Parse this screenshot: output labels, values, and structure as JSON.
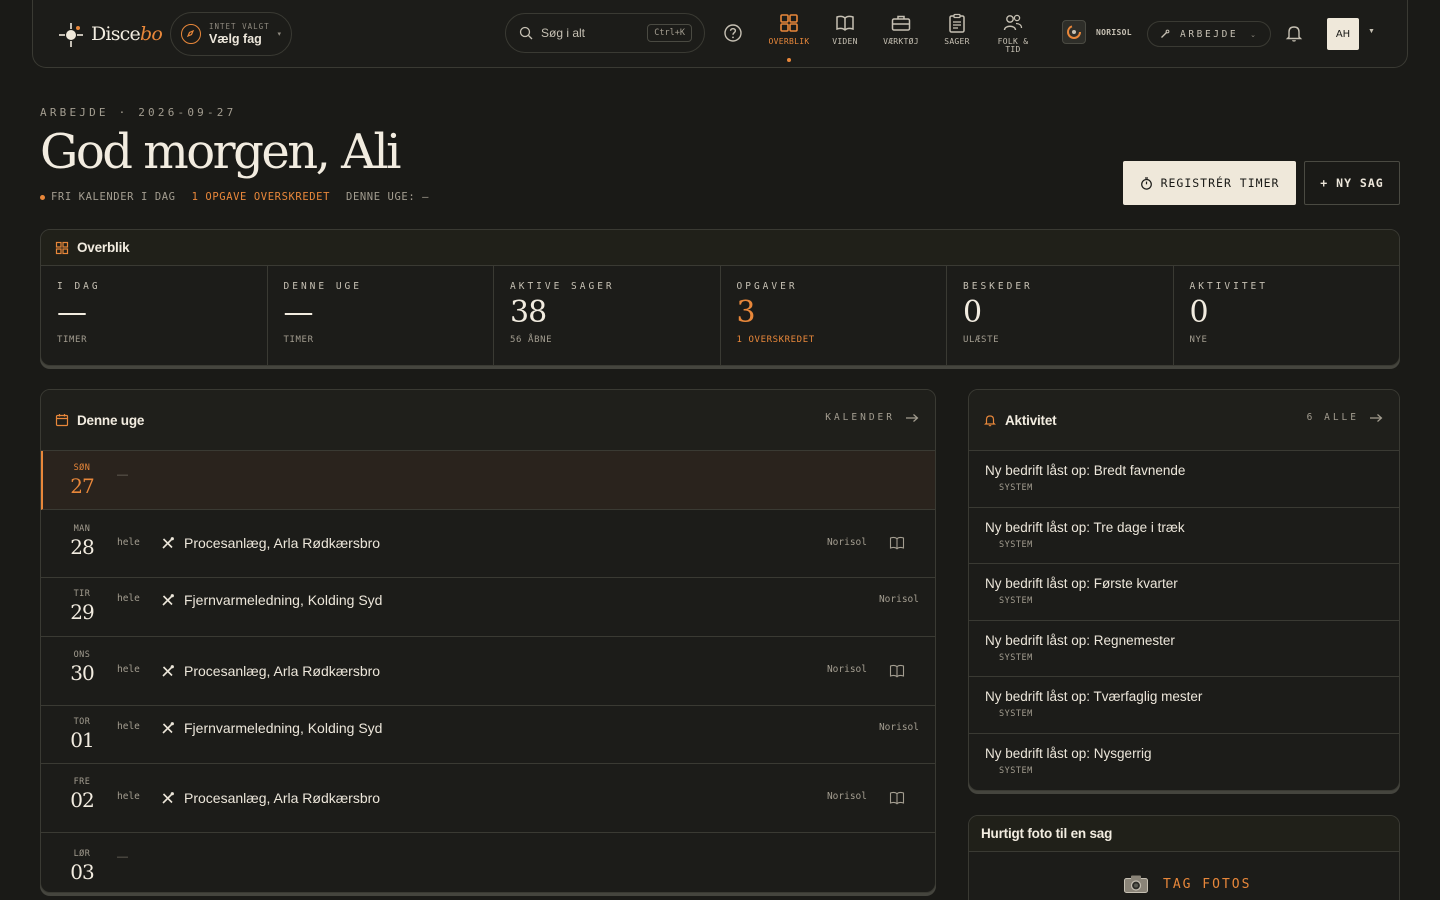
{
  "brand": {
    "name_main": "Disce",
    "name_italic": "bo"
  },
  "fag": {
    "small": "INTET VALGT",
    "label": "Vælg fag"
  },
  "search": {
    "placeholder": "Søg i alt",
    "shortcut": "Ctrl+K"
  },
  "nav": [
    {
      "label": "OVERBLIK",
      "icon": "grid-icon",
      "active": true
    },
    {
      "label": "VIDEN",
      "icon": "book-icon",
      "active": false
    },
    {
      "label": "VÆRKTØJ",
      "icon": "toolbox-icon",
      "active": false
    },
    {
      "label": "SAGER",
      "icon": "clipboard-icon",
      "active": false
    },
    {
      "label": "FOLK & TID",
      "icon": "people-icon",
      "active": false
    }
  ],
  "company": {
    "name": "NORISOL"
  },
  "mode": {
    "label": "ARBEJDE"
  },
  "user": {
    "initials": "AH"
  },
  "header": {
    "eyebrow": "ARBEJDE · 2026-09-27",
    "greeting": "God morgen, Ali",
    "status_free": "FRI KALENDER I DAG",
    "status_overdue": "1 OPGAVE OVERSKREDET",
    "status_week": "DENNE UGE: —",
    "btn_register": "REGISTRÉR TIMER",
    "btn_new": "+ NY SAG"
  },
  "overview": {
    "title": "Overblik",
    "stats": [
      {
        "label": "I DAG",
        "value": "—",
        "sub": "TIMER",
        "accent": false
      },
      {
        "label": "DENNE UGE",
        "value": "—",
        "sub": "TIMER",
        "accent": false
      },
      {
        "label": "AKTIVE SAGER",
        "value": "38",
        "sub": "56 ÅBNE",
        "accent": false
      },
      {
        "label": "OPGAVER",
        "value": "3",
        "sub": "1 OVERSKREDET",
        "accent": true
      },
      {
        "label": "BESKEDER",
        "value": "0",
        "sub": "ULÆSTE",
        "accent": false
      },
      {
        "label": "AKTIVITET",
        "value": "0",
        "sub": "NYE",
        "accent": false
      }
    ]
  },
  "week": {
    "title": "Denne uge",
    "link": "KALENDER",
    "days": [
      {
        "name": "SØN",
        "date": "27",
        "today": true,
        "entry": null,
        "empty": "—"
      },
      {
        "name": "MAN",
        "date": "28",
        "today": false,
        "entry": {
          "span": "hele",
          "title": "Procesanlæg, Arla Rødkærsbro",
          "company": "Norisol",
          "book": true
        }
      },
      {
        "name": "TIR",
        "date": "29",
        "today": false,
        "entry": {
          "span": "hele",
          "title": "Fjernvarmeledning, Kolding Syd",
          "company": "Norisol",
          "book": false
        }
      },
      {
        "name": "ONS",
        "date": "30",
        "today": false,
        "entry": {
          "span": "hele",
          "title": "Procesanlæg, Arla Rødkærsbro",
          "company": "Norisol",
          "book": true
        }
      },
      {
        "name": "TOR",
        "date": "01",
        "today": false,
        "entry": {
          "span": "hele",
          "title": "Fjernvarmeledning, Kolding Syd",
          "company": "Norisol",
          "book": false
        }
      },
      {
        "name": "FRE",
        "date": "02",
        "today": false,
        "entry": {
          "span": "hele",
          "title": "Procesanlæg, Arla Rødkærsbro",
          "company": "Norisol",
          "book": true
        }
      },
      {
        "name": "LØR",
        "date": "03",
        "today": false,
        "entry": null,
        "empty": "—"
      }
    ]
  },
  "activity": {
    "title": "Aktivitet",
    "link": "6 ALLE",
    "items": [
      {
        "text": "Ny bedrift låst op: Bredt favnende",
        "source": "SYSTEM"
      },
      {
        "text": "Ny bedrift låst op: Tre dage i træk",
        "source": "SYSTEM"
      },
      {
        "text": "Ny bedrift låst op: Første kvarter",
        "source": "SYSTEM"
      },
      {
        "text": "Ny bedrift låst op: Regnemester",
        "source": "SYSTEM"
      },
      {
        "text": "Ny bedrift låst op: Tværfaglig mester",
        "source": "SYSTEM"
      },
      {
        "text": "Ny bedrift låst op: Nysgerrig",
        "source": "SYSTEM"
      }
    ]
  },
  "photo": {
    "title": "Hurtigt foto til en sag",
    "button": "TAG FOTOS"
  },
  "colors": {
    "accent": "#e8873a",
    "background": "#1a1a17",
    "text": "#ece6da",
    "button_light": "#efe8da"
  }
}
